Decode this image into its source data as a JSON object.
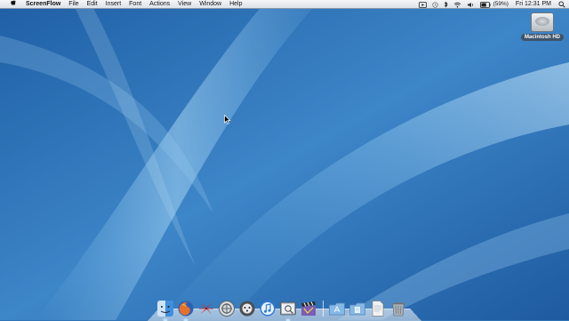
{
  "menubar": {
    "apple_icon": "apple-icon",
    "app_name": "ScreenFlow",
    "items": [
      "File",
      "Edit",
      "Insert",
      "Font",
      "Actions",
      "View",
      "Window",
      "Help"
    ],
    "status": {
      "screen_record_icon": "screen-record-icon",
      "time_machine_icon": "time-machine-icon",
      "bluetooth_icon": "bluetooth-icon",
      "wifi_icon": "wifi-icon",
      "volume_icon": "volume-icon",
      "battery_icon": "battery-icon",
      "battery_text": "(59%)",
      "clock": "Fri 12:31 PM",
      "spotlight_icon": "spotlight-icon"
    }
  },
  "desktop": {
    "hd_label": "Macintosh HD",
    "wallpaper_colors": [
      "#1f5fa5",
      "#4c93d0",
      "#87c1ea"
    ]
  },
  "dock": {
    "items": [
      {
        "name": "finder-icon",
        "color": "#3f8fe0",
        "running": true
      },
      {
        "name": "firefox-icon",
        "color": "#e7702a",
        "running": true
      },
      {
        "name": "pinwheel-app-icon",
        "color": "#cf2b2b",
        "running": false
      },
      {
        "name": "network-utility-icon",
        "color": "#8e969e",
        "running": false
      },
      {
        "name": "logic-app-icon",
        "color": "#4d4f53",
        "running": false
      },
      {
        "name": "itunes-icon",
        "color": "#2f7bd8",
        "running": false
      },
      {
        "name": "preview-app-icon",
        "color": "#9aa3ab",
        "running": true
      },
      {
        "name": "clapper-app-icon",
        "color": "#7c5db2",
        "running": false
      },
      {
        "name": "applications-folder-icon",
        "color": "#86b8e6",
        "running": false
      },
      {
        "name": "documents-folder-icon",
        "color": "#86b8e6",
        "running": false
      },
      {
        "name": "document-file-icon",
        "color": "#f2f2f2",
        "running": false
      },
      {
        "name": "trash-icon",
        "color": "#a9b0b6",
        "running": false
      }
    ]
  }
}
